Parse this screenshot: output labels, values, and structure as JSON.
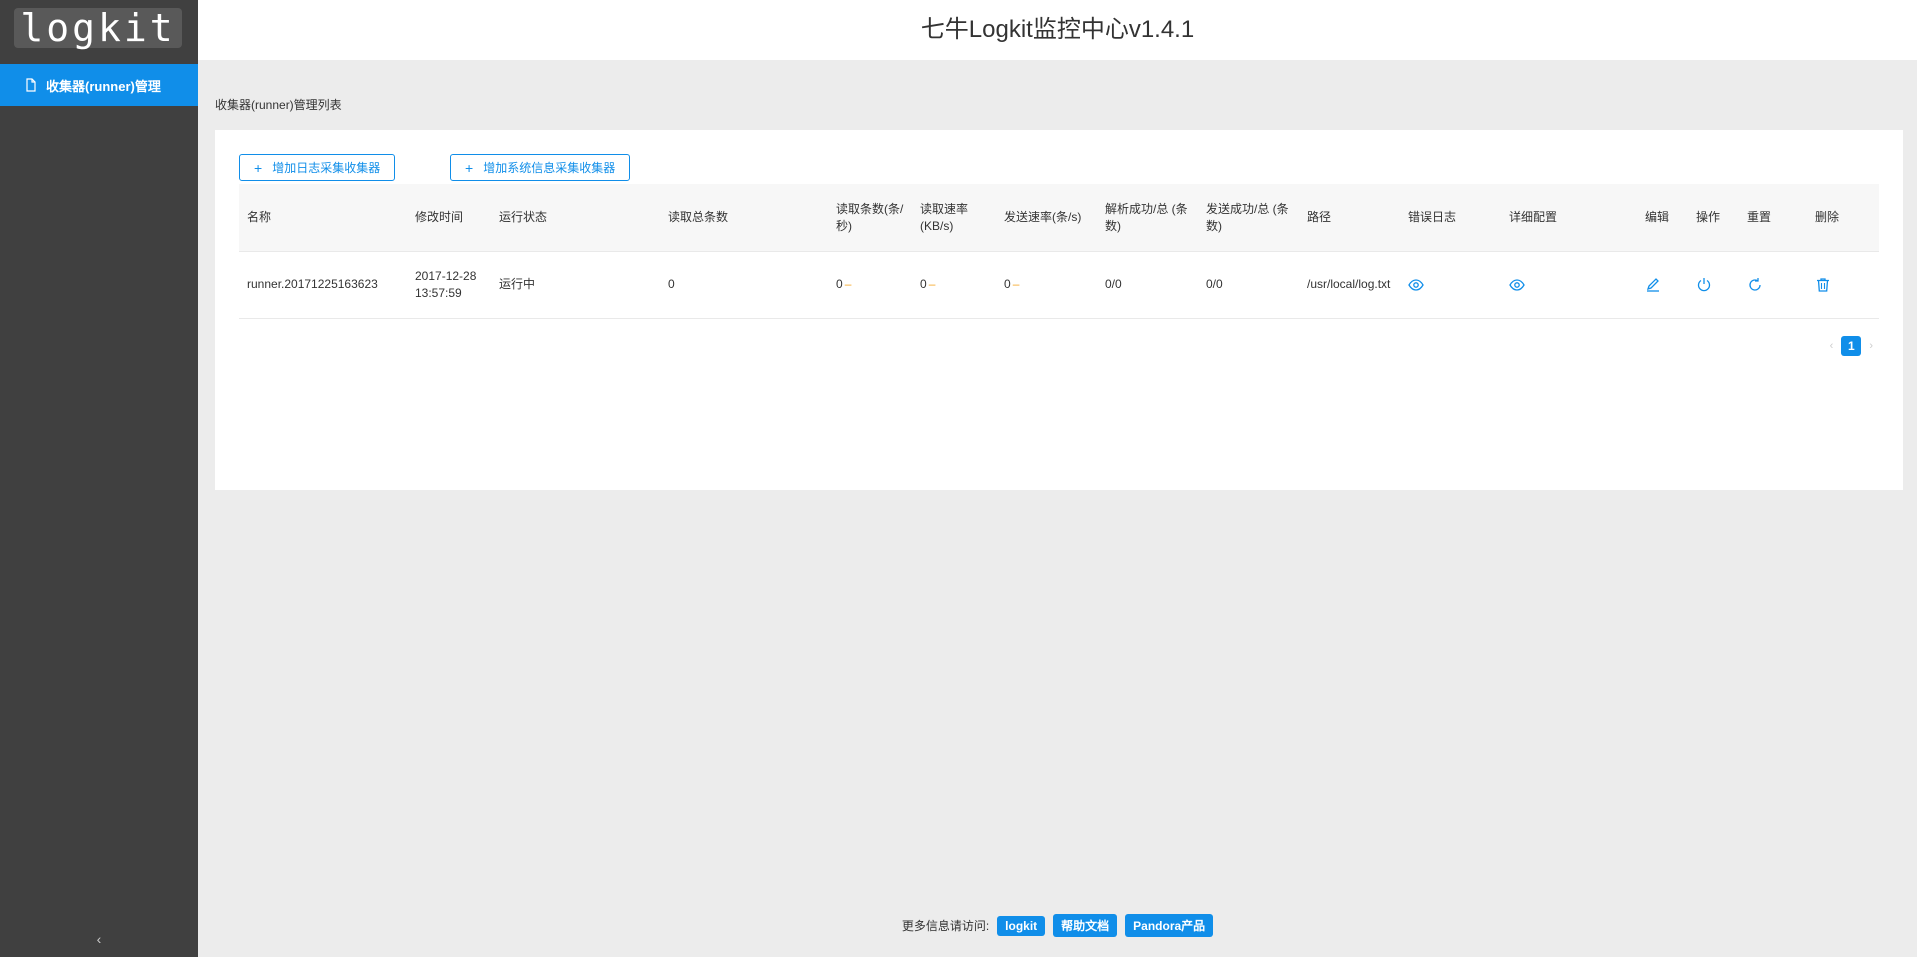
{
  "app": {
    "logo": "logkit",
    "header_title": "七牛Logkit监控中心v1.4.1"
  },
  "sidebar": {
    "items": [
      {
        "label": "收集器(runner)管理",
        "icon": "file-icon"
      }
    ],
    "collapse_icon": "chevron-left-icon"
  },
  "main": {
    "page_title": "收集器(runner)管理列表",
    "buttons": {
      "add_log_collector": "增加日志采集收集器",
      "add_system_collector": "增加系统信息采集收集器"
    },
    "table": {
      "columns": [
        "名称",
        "修改时间",
        "运行状态",
        "读取总条数",
        "读取条数(条/秒)",
        "读取速率(KB/s)",
        "发送速率(条/s)",
        "解析成功/总 (条数)",
        "发送成功/总 (条数)",
        "路径",
        "错误日志",
        "详细配置",
        "编辑",
        "操作",
        "重置",
        "删除"
      ],
      "rows": [
        {
          "name": "runner.20171225163623",
          "modified": "2017-12-28 13:57:59",
          "status": "运行中",
          "read_total": "0",
          "read_rate": "0",
          "read_speed": "0",
          "send_rate": "0",
          "parse_success": "0/0",
          "send_success": "0/0",
          "path": "/usr/local/log.txt",
          "trend_mark": "–",
          "icons": [
            "eye-icon",
            "eye-icon",
            "edit-icon",
            "power-icon",
            "reload-icon",
            "delete-icon"
          ]
        }
      ]
    },
    "pagination": {
      "current": "1",
      "prev": "‹",
      "next": "›"
    }
  },
  "footer": {
    "text": "更多信息请访问:",
    "links": [
      "logkit",
      "帮助文档",
      "Pandora产品"
    ]
  },
  "colors": {
    "accent": "#108ee9",
    "sidebar": "#404040",
    "trend": "#f5a623"
  }
}
